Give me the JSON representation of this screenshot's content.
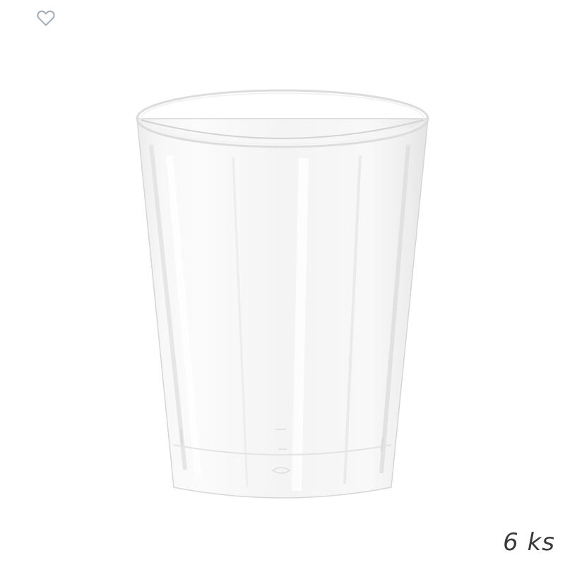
{
  "product": {
    "image_icon": "clear-plastic-cup",
    "quantity_label": "6 ks"
  },
  "favorite": {
    "icon": "heart-outline-icon",
    "color": "#9aa7b4"
  }
}
